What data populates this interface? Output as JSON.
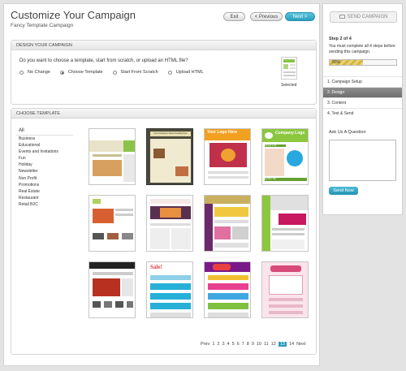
{
  "header": {
    "title": "Customize Your Campaign",
    "subtitle": "Fancy Template Campaign",
    "exit_label": "Exit",
    "prev_label": "< Previous",
    "next_label": "Next >"
  },
  "design": {
    "heading": "DESIGN YOUR CAMPAIGN",
    "question": "Do you want to choose a template, start from scratch, or upload an HTML file?",
    "options": [
      {
        "label": "No Change",
        "selected": false
      },
      {
        "label": "Choose Template",
        "selected": true
      },
      {
        "label": "Start From Scratch",
        "selected": false
      },
      {
        "label": "Upload HTML",
        "selected": false
      }
    ],
    "selected_label": "Selected"
  },
  "choose": {
    "heading": "CHOOSE TEMPLATE",
    "all_label": "All",
    "categories": [
      "Business",
      "Educational",
      "Events and Invitations",
      "Fun",
      "Holiday",
      "Newsletter",
      "Non Profit",
      "Promotions",
      "Real Estate",
      "Restaurant",
      "Retail B2C"
    ],
    "pager": {
      "prev": "Prev",
      "pages": [
        "1",
        "2",
        "3",
        "4",
        "5",
        "6",
        "7",
        "8",
        "9",
        "10",
        "11",
        "12",
        "13",
        "14"
      ],
      "current": "13",
      "next": "Next"
    },
    "template_texts": {
      "t2": "Your Company's Name Heading Here",
      "t3": "Your Logo Here",
      "t4": "Company Logo",
      "t4b": "Spread a Tile",
      "t4c": "Another Title",
      "t9": "Sale!"
    }
  },
  "sidebar": {
    "send_label": "SEND CAMPAIGN",
    "step_title": "Step 2 of 4",
    "step_desc": "You must complete all 4 steps before sending this campaign.",
    "progress_value": 50,
    "progress_label": "50%",
    "steps": [
      {
        "label": "1. Campaign Setup",
        "active": false
      },
      {
        "label": "2. Design",
        "active": true
      },
      {
        "label": "3. Content",
        "active": false
      },
      {
        "label": "4. Test & Send",
        "active": false
      }
    ],
    "ask_label": "Ask Us A Question",
    "send_now_label": "Send Now"
  },
  "colors": {
    "accent": "#2b9bbd",
    "active_step": "#7e7e7e"
  }
}
